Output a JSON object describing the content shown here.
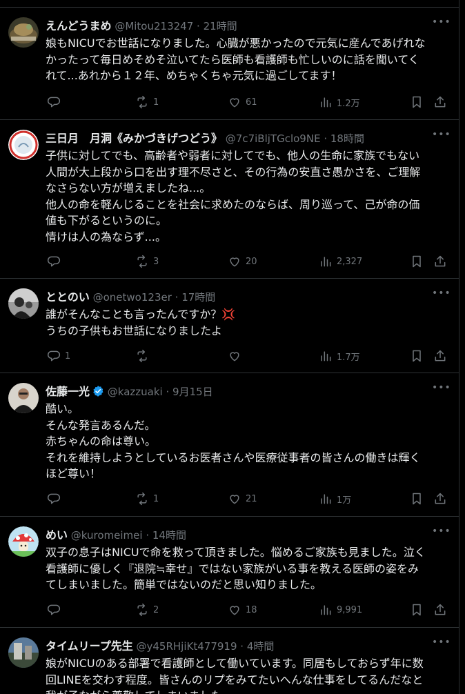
{
  "tweets": [
    {
      "name": "えんどうまめ",
      "handle": "@Mitou213247",
      "time": "21時間",
      "lines": [
        "娘もNICUでお世話になりました。心臓が悪かったので元気に産んであげれな",
        "かったって毎日めそめそ泣いてたら医師も看護師も忙しいのに話を聞いてく",
        "れて...あれから１２年、めちゃくちゃ元気に過ごしてます！"
      ],
      "reply": "",
      "retweet": "1",
      "like": "61",
      "views": "1.2万",
      "avatar": "avatar-photo-terrarium"
    },
    {
      "name": "三日月　月洞《みかづきげつどう》",
      "handle": "@7c7iBljTGclo9NE",
      "time": "18時間",
      "lines": [
        "子供に対してでも、高齢者や弱者に対してでも、他人の生命に家族でもない",
        "人間が大上段から口を出す理不尽さと、その行為の安直さ愚かさを、ご理解",
        "なさらない方が増えましたね...。",
        "他人の命を軽んじることを社会に求めたのならば、周り巡って、己が命の価",
        "値も下がるというのに。",
        "情けは人の為ならず...。"
      ],
      "reply": "",
      "retweet": "3",
      "like": "20",
      "views": "2,327",
      "avatar": "avatar-emblem-red-ring"
    },
    {
      "name": "ととのい",
      "handle": "@onetwo123er",
      "time": "17時間",
      "lines": [
        "誰がそんなことも言ったんですか？💢",
        "うちの子供もお世話になりましたよ"
      ],
      "reply": "1",
      "retweet": "",
      "like": "",
      "views": "1.7万",
      "avatar": "avatar-photo-monochrome"
    },
    {
      "name": "佐藤一光",
      "handle": "@kazzuaki",
      "time": "9月15日",
      "verified": true,
      "lines": [
        "酷い。",
        "そんな発言あるんだ。",
        "赤ちゃんの命は尊い。",
        "それを維持しようとしているお医者さんや医療従事者の皆さんの働きは輝く",
        "ほど尊い！"
      ],
      "reply": "",
      "retweet": "1",
      "like": "21",
      "views": "1万",
      "avatar": "avatar-photo-man"
    },
    {
      "name": "めい",
      "handle": "@kuromeimei",
      "time": "14時間",
      "lines": [
        "双子の息子はNICUで命を救って頂きました。悩めるご家族も見ました。泣く",
        "看護師に優しく『退院≒幸せ』ではない家族がいる事を教える医師の姿をみ",
        "てしまいました。簡単ではないのだと思い知りました。"
      ],
      "reply": "",
      "retweet": "2",
      "like": "18",
      "views": "9,991",
      "avatar": "avatar-mushroom-illustration"
    },
    {
      "name": "タイムリープ先生",
      "handle": "@y45RHjiKt477919",
      "time": "4時間",
      "lines": [
        "娘がNICUのある部署で看護師として働いています。同居もしておらず年に数",
        "回LINEを交わす程度。皆さんのリプをみてたいへんな仕事をしてるんだなと",
        "我が子ながら尊敬してしまいました。"
      ],
      "reply": "",
      "retweet": "",
      "like": "",
      "views": "",
      "avatar": "avatar-photo-building"
    }
  ],
  "colors": {
    "background": "#000000",
    "text": "#e7e9ea",
    "secondary": "#71767b",
    "border": "#2f3336",
    "verified": "#1d9bf0",
    "anger_emoji": "#f4212e"
  },
  "icons": [
    "reply-icon",
    "retweet-icon",
    "like-icon",
    "views-icon",
    "bookmark-icon",
    "share-icon",
    "more-icon",
    "verified-badge-icon"
  ]
}
